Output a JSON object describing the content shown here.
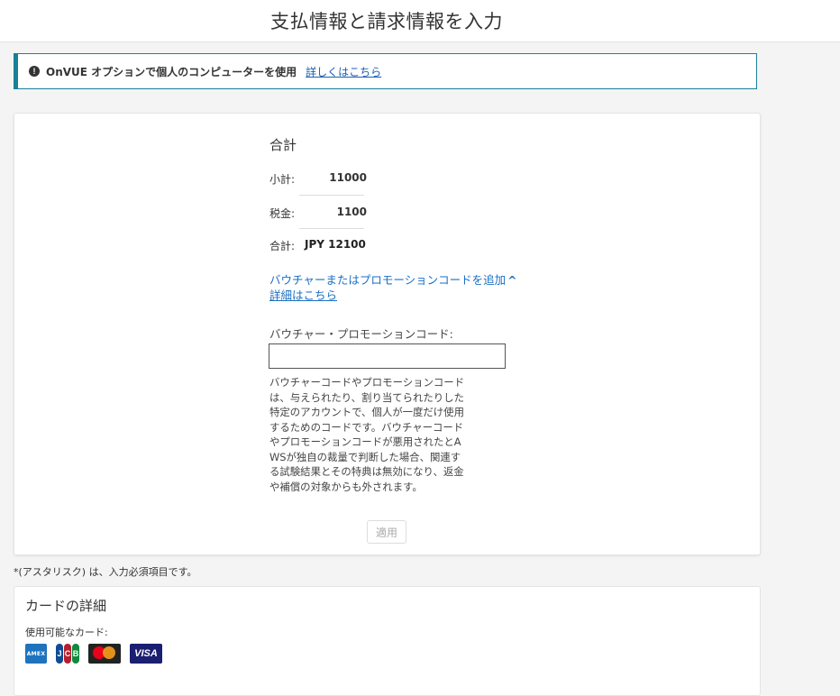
{
  "header": {
    "title": "支払情報と請求情報を入力"
  },
  "banner": {
    "text": "OnVUE オプションで個人のコンピューターを使用",
    "link": "詳しくはこちら",
    "icon": "info-icon"
  },
  "totals": {
    "title": "合計",
    "subtotal_label": "小計:",
    "subtotal_value": "11000",
    "tax_label": "税金:",
    "tax_value": "1100",
    "total_label": "合計:",
    "total_value": "JPY 12100"
  },
  "voucher": {
    "toggle_label": "バウチャーまたはプロモーションコードを追加",
    "detail_link": "詳細はこちら",
    "field_label": "バウチャー・プロモーションコード:",
    "field_value": "",
    "field_placeholder": "",
    "note": "バウチャーコードやプロモーションコードは、与えられたり、割り当てられたりした特定のアカウントで、個人が一度だけ使用するためのコードです。バウチャーコードやプロモーションコードが悪用されたとAWSが独自の裁量で判断した場合、関連する試験結果とその特典は無効になり、返金や補償の対象からも外されます。",
    "apply_label": "適用"
  },
  "required_note": "*(アスタリスク) は、入力必須項目です。",
  "card": {
    "title": "カードの詳細",
    "available_label": "使用可能なカード:",
    "logos": [
      "AMEX",
      "JCB",
      "mastercard",
      "VISA"
    ]
  },
  "colors": {
    "accent": "#1a7f99",
    "link": "#1a6fc4"
  }
}
